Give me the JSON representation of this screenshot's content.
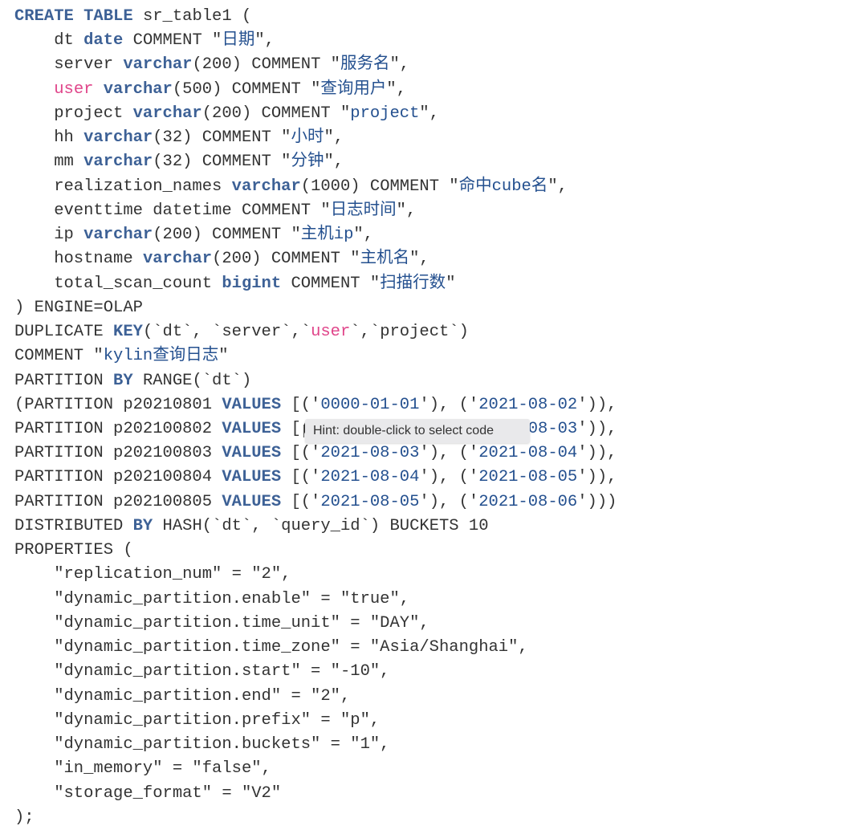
{
  "code": {
    "lines": [
      [
        [
          "k",
          "CREATE"
        ],
        [
          "t",
          " "
        ],
        [
          "k",
          "TABLE"
        ],
        [
          "t",
          " sr_table1 ("
        ]
      ],
      [
        [
          "t",
          "    dt "
        ],
        [
          "k",
          "date"
        ],
        [
          "t",
          " COMMENT \""
        ],
        [
          "s",
          "日期"
        ],
        [
          "t",
          "\","
        ]
      ],
      [
        [
          "t",
          "    server "
        ],
        [
          "k",
          "varchar"
        ],
        [
          "t",
          "(200) COMMENT \""
        ],
        [
          "s",
          "服务名"
        ],
        [
          "t",
          "\","
        ]
      ],
      [
        [
          "t",
          "    "
        ],
        [
          "p",
          "user"
        ],
        [
          "t",
          " "
        ],
        [
          "k",
          "varchar"
        ],
        [
          "t",
          "(500) COMMENT \""
        ],
        [
          "s",
          "查询用户"
        ],
        [
          "t",
          "\","
        ]
      ],
      [
        [
          "t",
          "    project "
        ],
        [
          "k",
          "varchar"
        ],
        [
          "t",
          "(200) COMMENT \""
        ],
        [
          "s",
          "project"
        ],
        [
          "t",
          "\","
        ]
      ],
      [
        [
          "t",
          "    hh "
        ],
        [
          "k",
          "varchar"
        ],
        [
          "t",
          "(32) COMMENT \""
        ],
        [
          "s",
          "小时"
        ],
        [
          "t",
          "\","
        ]
      ],
      [
        [
          "t",
          "    mm "
        ],
        [
          "k",
          "varchar"
        ],
        [
          "t",
          "(32) COMMENT \""
        ],
        [
          "s",
          "分钟"
        ],
        [
          "t",
          "\","
        ]
      ],
      [
        [
          "t",
          "    realization_names "
        ],
        [
          "k",
          "varchar"
        ],
        [
          "t",
          "(1000) COMMENT \""
        ],
        [
          "s",
          "命中cube名"
        ],
        [
          "t",
          "\","
        ]
      ],
      [
        [
          "t",
          "    eventtime datetime COMMENT \""
        ],
        [
          "s",
          "日志时间"
        ],
        [
          "t",
          "\","
        ]
      ],
      [
        [
          "t",
          "    ip "
        ],
        [
          "k",
          "varchar"
        ],
        [
          "t",
          "(200) COMMENT \""
        ],
        [
          "s",
          "主机ip"
        ],
        [
          "t",
          "\","
        ]
      ],
      [
        [
          "t",
          "    hostname "
        ],
        [
          "k",
          "varchar"
        ],
        [
          "t",
          "(200) COMMENT \""
        ],
        [
          "s",
          "主机名"
        ],
        [
          "t",
          "\","
        ]
      ],
      [
        [
          "t",
          "    total_scan_count "
        ],
        [
          "k",
          "bigint"
        ],
        [
          "t",
          " COMMENT \""
        ],
        [
          "s",
          "扫描行数"
        ],
        [
          "t",
          "\""
        ]
      ],
      [
        [
          "t",
          ") ENGINE=OLAP"
        ]
      ],
      [
        [
          "t",
          "DUPLICATE "
        ],
        [
          "k",
          "KEY"
        ],
        [
          "t",
          "(`dt`, `server`,`"
        ],
        [
          "p",
          "user"
        ],
        [
          "t",
          "`,`project`)"
        ]
      ],
      [
        [
          "t",
          "COMMENT \""
        ],
        [
          "s",
          "kylin查询日志"
        ],
        [
          "t",
          "\""
        ]
      ],
      [
        [
          "t",
          "PARTITION "
        ],
        [
          "k",
          "BY"
        ],
        [
          "t",
          " RANGE(`dt`)"
        ]
      ],
      [
        [
          "t",
          "(PARTITION p20210801 "
        ],
        [
          "k",
          "VALUES"
        ],
        [
          "t",
          " [('"
        ],
        [
          "s",
          "0000-01-01"
        ],
        [
          "t",
          "'), ('"
        ],
        [
          "s",
          "2021-08-02"
        ],
        [
          "t",
          "')),"
        ]
      ],
      [
        [
          "t",
          "PARTITION p202100802 "
        ],
        [
          "k",
          "VALUES"
        ],
        [
          "t",
          " [('"
        ],
        [
          "s",
          "2021-08-02"
        ],
        [
          "t",
          "'), ('"
        ],
        [
          "s",
          "2021-08-03"
        ],
        [
          "t",
          "')),"
        ]
      ],
      [
        [
          "t",
          "PARTITION p202100803 "
        ],
        [
          "k",
          "VALUES"
        ],
        [
          "t",
          " [('"
        ],
        [
          "s",
          "2021-08-03"
        ],
        [
          "t",
          "'), ('"
        ],
        [
          "s",
          "2021-08-04"
        ],
        [
          "t",
          "')),"
        ]
      ],
      [
        [
          "t",
          "PARTITION p202100804 "
        ],
        [
          "k",
          "VALUES"
        ],
        [
          "t",
          " [('"
        ],
        [
          "s",
          "2021-08-04"
        ],
        [
          "t",
          "'), ('"
        ],
        [
          "s",
          "2021-08-05"
        ],
        [
          "t",
          "')),"
        ]
      ],
      [
        [
          "t",
          "PARTITION p202100805 "
        ],
        [
          "k",
          "VALUES"
        ],
        [
          "t",
          " [('"
        ],
        [
          "s",
          "2021-08-05"
        ],
        [
          "t",
          "'), ('"
        ],
        [
          "s",
          "2021-08-06"
        ],
        [
          "t",
          "')))"
        ]
      ],
      [
        [
          "t",
          "DISTRIBUTED "
        ],
        [
          "k",
          "BY"
        ],
        [
          "t",
          " HASH(`dt`, `query_id`) BUCKETS 10"
        ]
      ],
      [
        [
          "t",
          "PROPERTIES ("
        ]
      ],
      [
        [
          "t",
          "    \"replication_num\" = \"2\","
        ]
      ],
      [
        [
          "t",
          "    \"dynamic_partition.enable\" = \"true\","
        ]
      ],
      [
        [
          "t",
          "    \"dynamic_partition.time_unit\" = \"DAY\","
        ]
      ],
      [
        [
          "t",
          "    \"dynamic_partition.time_zone\" = \"Asia/Shanghai\","
        ]
      ],
      [
        [
          "t",
          "    \"dynamic_partition.start\" = \"-10\","
        ]
      ],
      [
        [
          "t",
          "    \"dynamic_partition.end\" = \"2\","
        ]
      ],
      [
        [
          "t",
          "    \"dynamic_partition.prefix\" = \"p\","
        ]
      ],
      [
        [
          "t",
          "    \"dynamic_partition.buckets\" = \"1\","
        ]
      ],
      [
        [
          "t",
          "    \"in_memory\" = \"false\","
        ]
      ],
      [
        [
          "t",
          "    \"storage_format\" = \"V2\""
        ]
      ],
      [
        [
          "t",
          ");"
        ]
      ]
    ]
  },
  "hint": {
    "text": "Hint: double-click to select code"
  },
  "colors": {
    "keyword": "#3d6196",
    "string": "#24508f",
    "identifier_pink": "#e0458a",
    "text": "#333333"
  }
}
